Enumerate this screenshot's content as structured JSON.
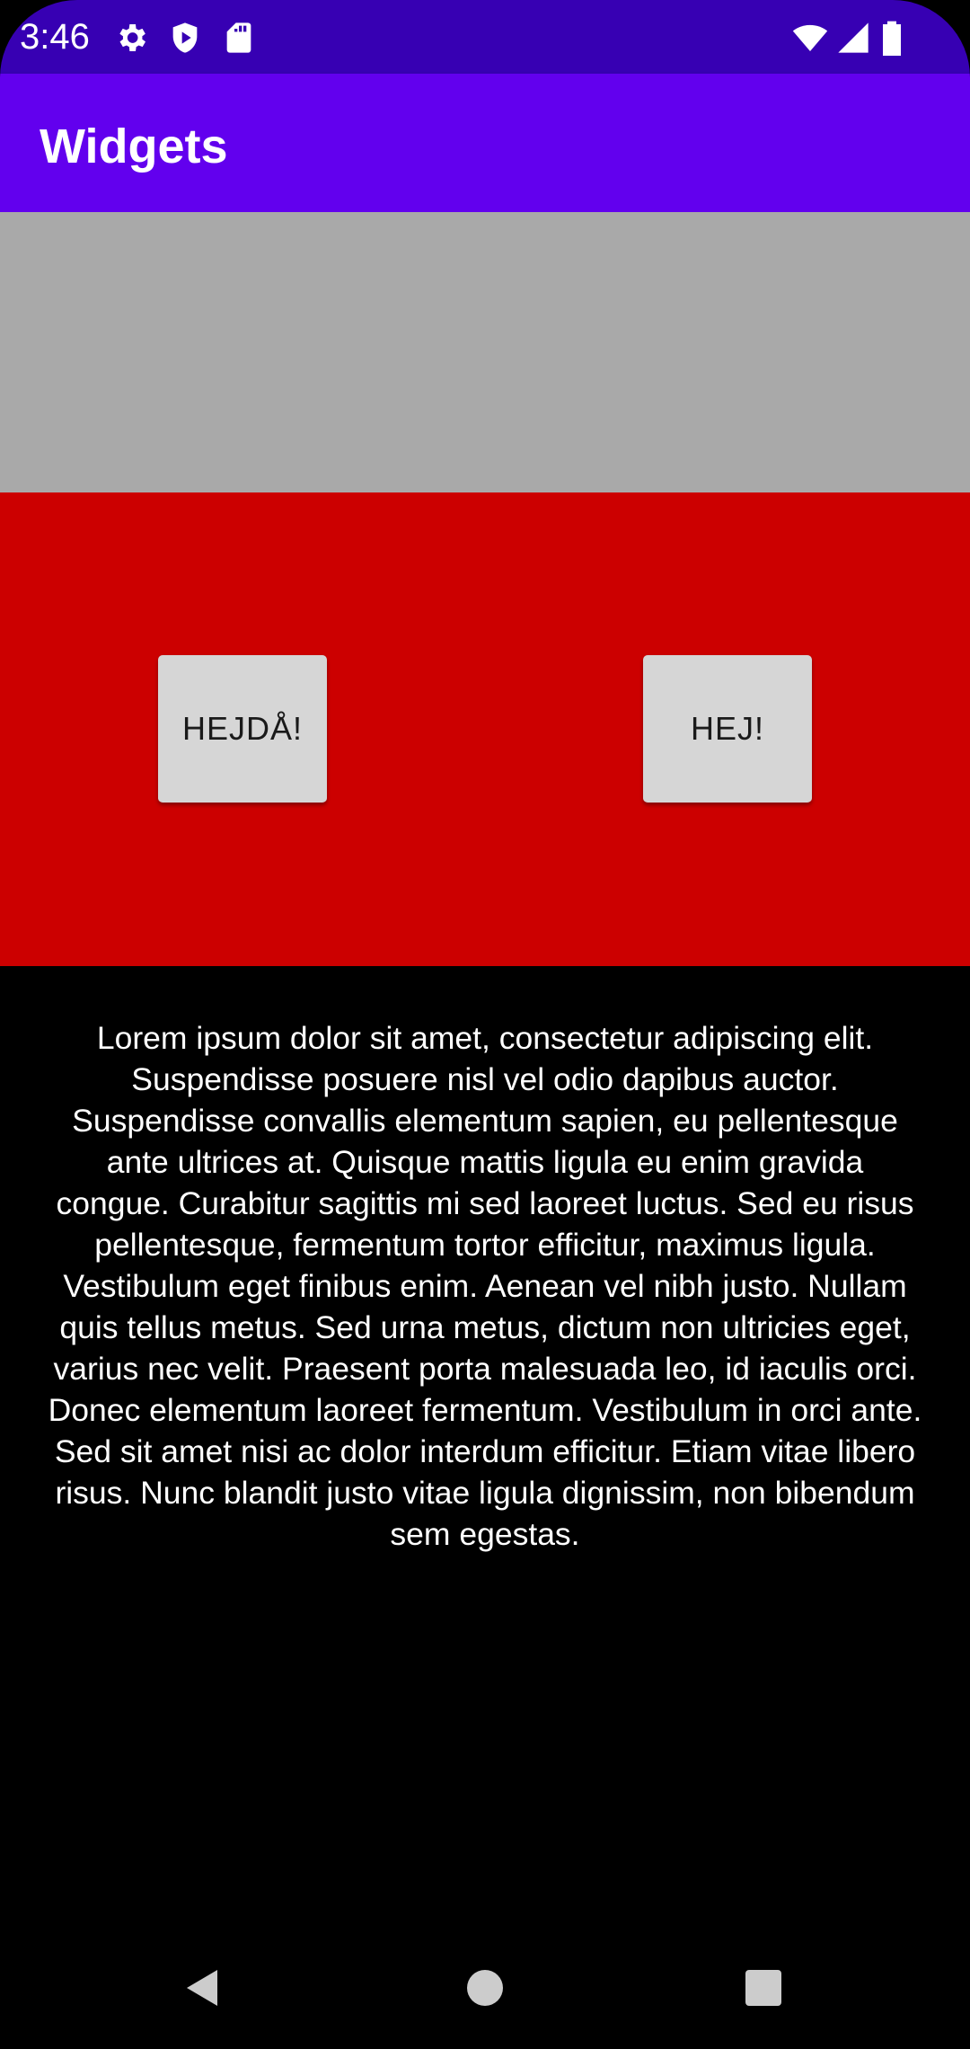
{
  "status_bar": {
    "time": "3:46",
    "left_icons": [
      "gear-icon",
      "shield-icon",
      "sd-card-icon"
    ],
    "right_icons": [
      "wifi-icon",
      "signal-icon",
      "battery-icon"
    ]
  },
  "app_bar": {
    "title": "Widgets"
  },
  "buttons": {
    "left_label": "HEJDÅ!",
    "right_label": "HEJ!"
  },
  "content": {
    "text": "Lorem ipsum dolor sit amet, consectetur adipiscing elit. Suspendisse posuere nisl vel odio dapibus auctor. Suspendisse convallis elementum sapien, eu pellentesque ante ultrices at. Quisque mattis ligula eu enim gravida congue. Curabitur sagittis mi sed laoreet luctus. Sed eu risus pellentesque, fermentum tortor efficitur, maximus ligula. Vestibulum eget finibus enim. Aenean vel nibh justo.  Nullam quis tellus metus. Sed urna metus, dictum non ultricies eget, varius nec velit. Praesent porta malesuada leo, id iaculis orci. Donec elementum laoreet fermentum. Vestibulum in orci ante. Sed sit amet nisi ac dolor interdum efficitur. Etiam vitae libero risus. Nunc blandit justo vitae ligula dignissim, non bibendum sem egestas."
  },
  "nav_bar": {
    "icons": [
      "back-icon",
      "home-icon",
      "recents-icon"
    ]
  },
  "colors": {
    "status_bar": "#3700b3",
    "app_bar": "#6200ee",
    "gray_band": "#a9a9a9",
    "red_band": "#cc0000",
    "button": "#d6d6d6",
    "background": "#000000",
    "text": "#ffffff"
  }
}
